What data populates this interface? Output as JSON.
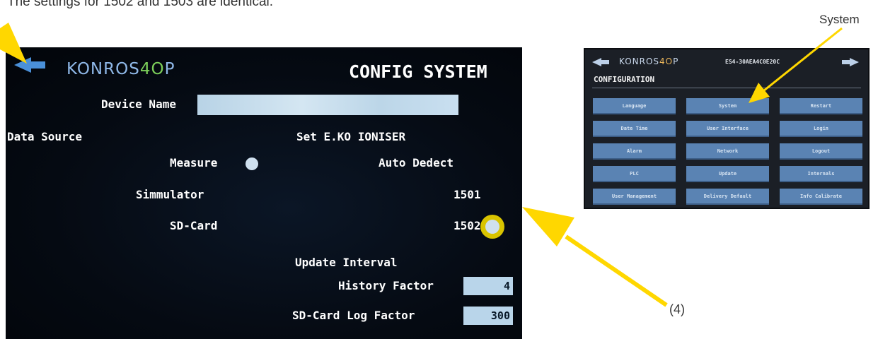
{
  "intro_text": "The settings for 1502 and 1503 are identical.",
  "callouts": {
    "system": "System",
    "step": "(4)"
  },
  "screen": {
    "logo_main": "KONROS",
    "logo_accent": "4O",
    "logo_end": "P",
    "title": "CONFIG SYSTEM",
    "device_name_label": "Device Name",
    "device_name_value": "",
    "data_source_label": "Data Source",
    "set_ioniser_label": "Set E.KO IONISER",
    "sources": [
      "Measure",
      "Simmulator",
      "SD-Card"
    ],
    "ioniser_options": [
      "Auto Dedect",
      "1501",
      "1502"
    ],
    "selected_ioniser": "1502",
    "update_interval_label": "Update Interval",
    "history_factor_label": "History Factor",
    "history_factor_value": "4",
    "sd_log_factor_label": "SD-Card Log Factor",
    "sd_log_factor_value": "300"
  },
  "thumbnail": {
    "logo_main": "KONROS",
    "logo_accent": "4O",
    "logo_end": "P",
    "device_id": "ES4-30AEA4C0E20C",
    "heading": "CONFIGURATION",
    "buttons": [
      "Language",
      "System",
      "Restart",
      "Date Time",
      "User Interface",
      "Login",
      "Alarm",
      "Network",
      "Logout",
      "PLC",
      "Update",
      "Internals",
      "User Management",
      "Delivery Default",
      "Info Calibrate"
    ]
  },
  "colors": {
    "arrow": "#ffd700",
    "accent": "#4a90d9",
    "selected": "#d9c400"
  }
}
